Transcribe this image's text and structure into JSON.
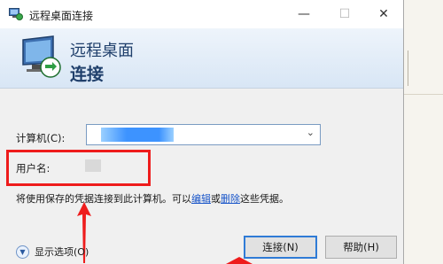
{
  "window": {
    "title": "远程桌面连接",
    "controls": {
      "minimize": "—",
      "maximize": "☐",
      "close": "✕"
    }
  },
  "banner": {
    "line1": "远程桌面",
    "line2": "连接"
  },
  "form": {
    "computer_label": "计算机(C):",
    "user_label": "用户名:",
    "info_prefix": "将使用保存的凭据连接到此计算机。可以",
    "info_edit": "编辑",
    "info_or": "或",
    "info_delete": "删除",
    "info_suffix": "这些凭据。"
  },
  "footer": {
    "show_options": "显示选项(O)",
    "connect": "连接(N)",
    "help": "帮助(H)"
  },
  "colors": {
    "annotation": "#ee1c1c",
    "link": "#1a56c9",
    "banner_text": "#1f3f6b"
  },
  "icons": [
    "remote-desktop-icon",
    "chevron-down-icon",
    "expand-options-icon"
  ]
}
